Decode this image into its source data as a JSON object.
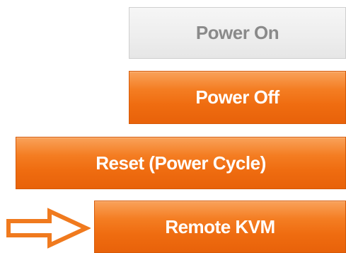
{
  "buttons": {
    "power_on": {
      "label": "Power On",
      "state": "disabled"
    },
    "power_off": {
      "label": "Power Off"
    },
    "reset": {
      "label": "Reset (Power Cycle)"
    },
    "remote_kvm": {
      "label": "Remote KVM"
    }
  },
  "annotation": {
    "icon": "arrow-right-outline-icon",
    "color": "#f07a1e"
  },
  "colors": {
    "accent": "#ef6c10",
    "disabled_bg": "#eeeeee",
    "disabled_text": "#8a8a8a",
    "button_text": "#ffffff"
  }
}
